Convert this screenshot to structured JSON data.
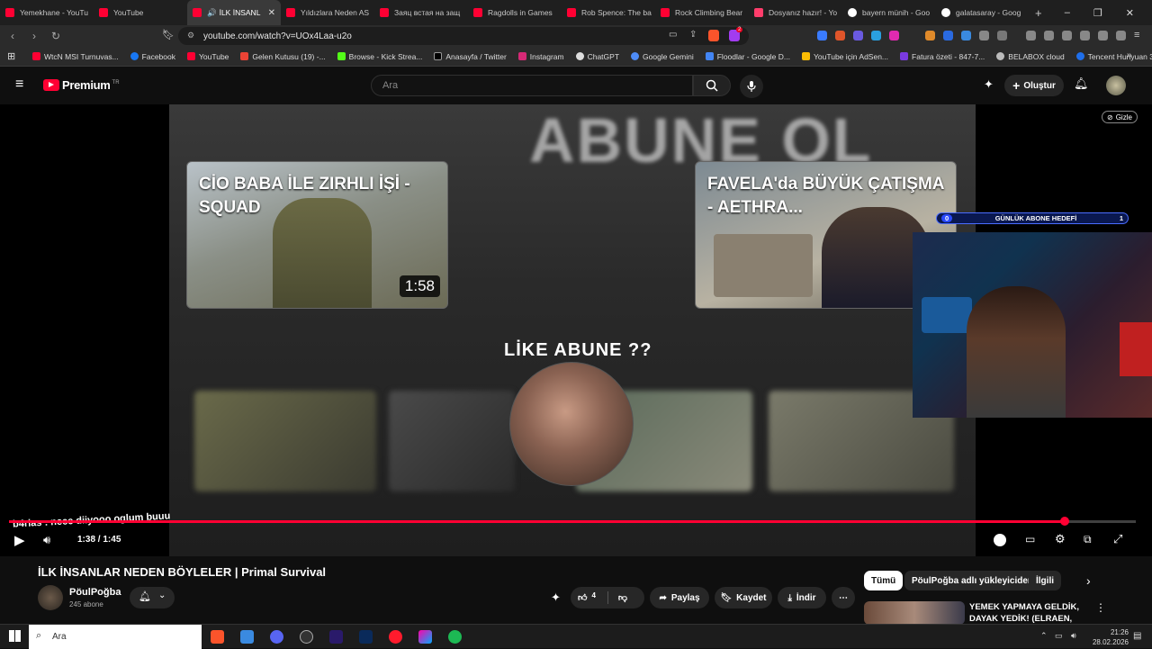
{
  "browser": {
    "tabs": [
      {
        "label": "Yemekhane - YouTu",
        "icon": "youtube-icon"
      },
      {
        "label": "YouTube",
        "icon": "youtube-icon"
      },
      {
        "label": "İLK İNSANL",
        "icon": "youtube-icon",
        "active": true
      },
      {
        "label": "Yıldızlara Neden AS",
        "icon": "youtube-icon"
      },
      {
        "label": "Заяц встая на защ",
        "icon": "youtube-icon"
      },
      {
        "label": "Ragdolls in Games",
        "icon": "youtube-icon"
      },
      {
        "label": "Rob Spence: The ba",
        "icon": "youtube-icon"
      },
      {
        "label": "Rock Climbing Bear",
        "icon": "youtube-icon"
      },
      {
        "label": "Dosyanız hazır! - Yo",
        "icon": "site-icon"
      },
      {
        "label": "bayern münih - Goo",
        "icon": "google-icon"
      },
      {
        "label": "galatasaray - Goog",
        "icon": "google-icon"
      }
    ],
    "new_tab_glyph": "+",
    "window_controls": [
      "–",
      "❐",
      "✕"
    ],
    "url": "youtube.com/watch?v=UOx4Laa-u2o",
    "bookmarks": [
      "WtcN MSI Turnuvas...",
      "Facebook",
      "YouTube",
      "Gelen Kutusu (19) -...",
      "Browse - Kick Strea...",
      "Anasayfa / Twitter",
      "Instagram",
      "ChatGPT",
      "Google Gemini",
      "Floodlar - Google D...",
      "YouTube için AdSen...",
      "Fatura özeti - 847-7...",
      "BELABOX cloud",
      "Tencent Hunyuan 3D"
    ],
    "brave_badge": "2"
  },
  "youtube": {
    "logo_text": "Premium",
    "logo_sup": "TR",
    "search_placeholder": "Ara",
    "create_label": "Oluştur"
  },
  "video": {
    "bg_text": "ABUNE OL",
    "end_cards": [
      {
        "title": "CİO BABA İLE ZIRHLI İŞİ - SQUAD",
        "duration": "1:58"
      },
      {
        "title": "FAVELA'da BÜYÜK ÇATIŞMA - AETHRA..."
      }
    ],
    "like_abune": "LİKE ABUNE ??",
    "overlay": {
      "goal_label": "GÜNLÜK ABONE HEDEFİ",
      "goal_current": "0",
      "goal_target": "1",
      "hide_label": "Gizle",
      "chat_line": "b4rias : neee diiyooo oglum buuu"
    },
    "time_current": "1:38",
    "time_total": "1:45",
    "progress": 0.937,
    "title": "İLK İNSANLAR NEDEN BÖYLELER | Primal Survival",
    "channel": "PöulPoğba",
    "subscribers": "245 abone",
    "likes": "4",
    "actions": {
      "share": "Paylaş",
      "save": "Kaydet",
      "download": "İndir"
    }
  },
  "sidebar": {
    "chips": [
      "Tümü",
      "PöulPoğba adlı yükleyiciden",
      "İlgili"
    ],
    "recommended_title": "YEMEK YAPMAYA GELDİK, DAYAK YEDİK! (ELRAEN, ERAY,..."
  },
  "taskbar": {
    "search_placeholder": "Ara",
    "time": "21:26",
    "date": "28.02.2026"
  },
  "colors": {
    "accent": "#ff0033",
    "goal_bar": "#0a1850"
  }
}
